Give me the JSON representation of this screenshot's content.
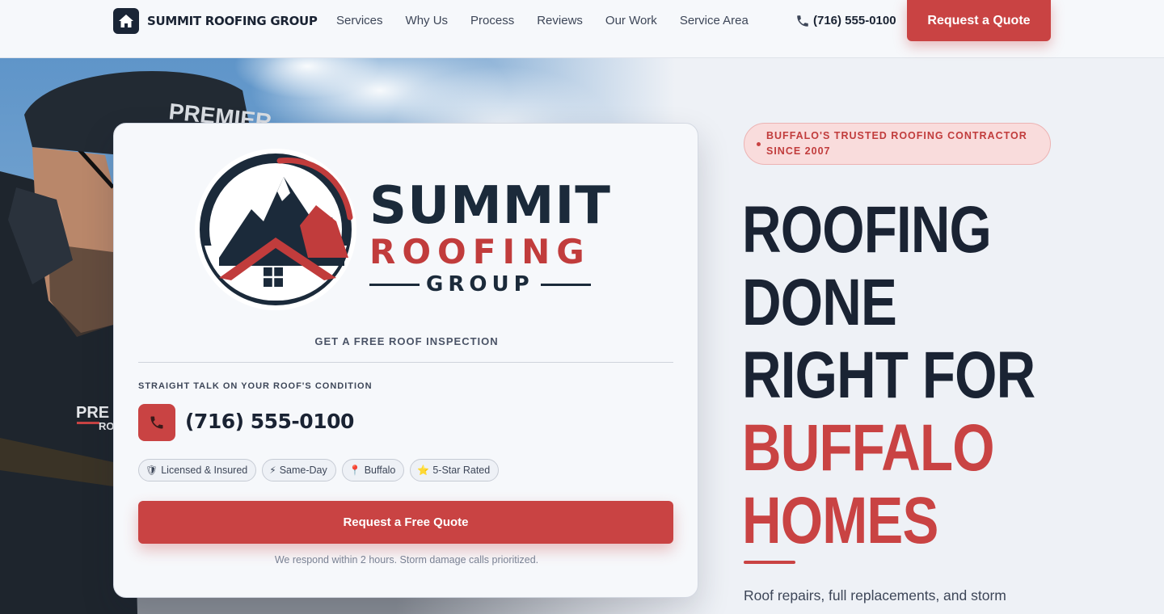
{
  "header": {
    "brand_name": "SUMMIT ROOFING GROUP",
    "nav": [
      "Services",
      "Why Us",
      "Process",
      "Reviews",
      "Our Work",
      "Service Area"
    ],
    "phone": "(716) 555-0100",
    "quote_button": "Request a Quote"
  },
  "hero_photo": {
    "cap_text": "PREMIER",
    "shirt_text": "PRE",
    "shirt_text2": "RO"
  },
  "card": {
    "logo": {
      "summit": "SUMMIT",
      "roofing": "ROOFING",
      "group": "GROUP"
    },
    "inspection_label": "GET A FREE ROOF INSPECTION",
    "talk_label": "STRAIGHT TALK ON YOUR ROOF'S CONDITION",
    "phone": "(716) 555-0100",
    "badges": [
      {
        "icon": "shield-icon",
        "glyph": "🛡",
        "label": "Licensed & Insured"
      },
      {
        "icon": "lightning-icon",
        "glyph": "⚡",
        "label": "Same-Day"
      },
      {
        "icon": "pin-icon",
        "glyph": "📍",
        "label": "Buffalo"
      },
      {
        "icon": "star-icon",
        "glyph": "⭐",
        "label": "5-Star Rated"
      }
    ],
    "cta_button": "Request a Free Quote",
    "response_note": "We respond within 2 hours. Storm damage calls prioritized."
  },
  "hero": {
    "pill_line1": "BUFFALO'S TRUSTED ROOFING CONTRACTOR",
    "pill_line2": "SINCE 2007",
    "headline_dark": [
      "ROOFING",
      "DONE",
      "RIGHT FOR"
    ],
    "headline_red": [
      "BUFFALO",
      "HOMES"
    ],
    "subheading": "Roof repairs, full replacements, and storm"
  },
  "colors": {
    "accent": "#c94343",
    "navy": "#1a2536",
    "background": "#eef1f6",
    "pill_bg": "#f9dcdc"
  }
}
